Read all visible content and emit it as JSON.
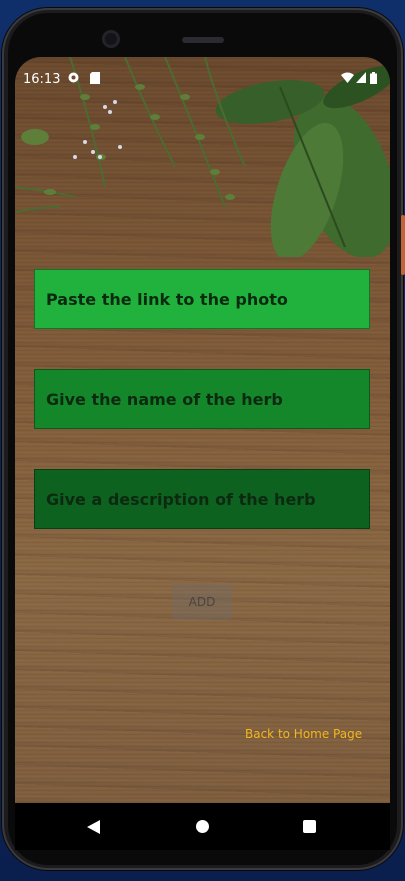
{
  "status_bar": {
    "time": "16:13"
  },
  "form": {
    "photo_link_placeholder": "Paste the link to the photo",
    "herb_name_placeholder": "Give the name of the herb",
    "herb_description_placeholder": "Give a description of the herb",
    "add_label": "ADD"
  },
  "links": {
    "back_home": "Back to Home Page"
  },
  "colors": {
    "field_1": "#21b13d",
    "field_2": "#15872b",
    "field_3": "#0e6220",
    "link": "#f2b81f"
  },
  "icons": {
    "status": [
      "app-notification-icon",
      "sd-card-icon",
      "wifi-icon",
      "signal-icon",
      "battery-icon"
    ],
    "nav": [
      "back-icon",
      "home-icon",
      "recents-icon"
    ]
  }
}
